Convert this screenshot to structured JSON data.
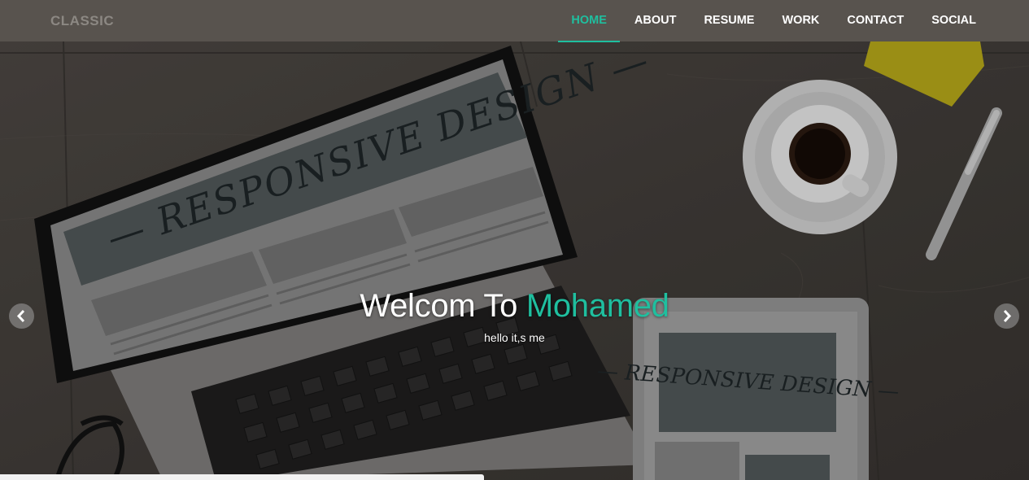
{
  "navbar": {
    "brand": "CLASSIC",
    "links": [
      {
        "label": "HOME",
        "active": true
      },
      {
        "label": "ABOUT"
      },
      {
        "label": "RESUME"
      },
      {
        "label": "WORK"
      },
      {
        "label": "CONTACT"
      },
      {
        "label": "SOCIAL"
      }
    ]
  },
  "hero": {
    "heading_prefix": "Welcom To ",
    "heading_name": "Mohamed",
    "subtitle": "hello it,s me",
    "laptop_screen_text": "— RESPONSIVE DESIGN —",
    "tablet_screen_text": "— RESPONSIVE DESIGN —",
    "prev_icon": "chevron-left-icon",
    "next_icon": "chevron-right-icon"
  },
  "colors": {
    "accent": "#1fbf9f",
    "navbar_bg": "#58534e",
    "brand_text": "#8c8883"
  }
}
